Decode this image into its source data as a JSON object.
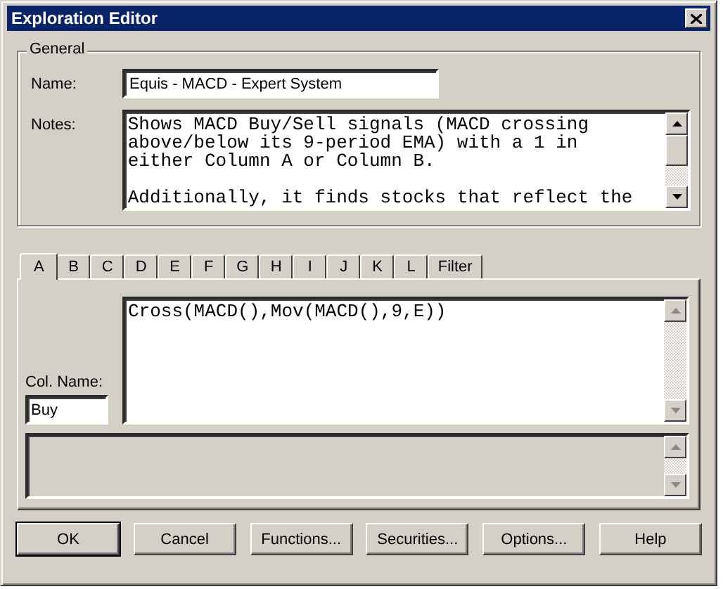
{
  "window": {
    "title": "Exploration Editor"
  },
  "general": {
    "title": "General",
    "name_label": "Name:",
    "name_value": "Equis - MACD - Expert System",
    "notes_label": "Notes:",
    "notes_paragraphs": [
      [
        "Shows MACD Buy/Sell signals (MACD crossing",
        "above/below its 9-period EMA) with a 1 in",
        "either Column A or Column B."
      ],
      [
        "Additionally, it finds stocks that reflect the"
      ]
    ]
  },
  "tabs": [
    {
      "label": "A",
      "selected": true
    },
    {
      "label": "B",
      "selected": false
    },
    {
      "label": "C",
      "selected": false
    },
    {
      "label": "D",
      "selected": false
    },
    {
      "label": "E",
      "selected": false
    },
    {
      "label": "F",
      "selected": false
    },
    {
      "label": "G",
      "selected": false
    },
    {
      "label": "H",
      "selected": false
    },
    {
      "label": "I",
      "selected": false
    },
    {
      "label": "J",
      "selected": false
    },
    {
      "label": "K",
      "selected": false
    },
    {
      "label": "L",
      "selected": false
    },
    {
      "label": "Filter",
      "selected": false
    }
  ],
  "column": {
    "formula": "Cross(MACD(),Mov(MACD(),9,E))",
    "col_name_label": "Col. Name:",
    "col_name_value": "Buy"
  },
  "buttons": [
    {
      "label": "OK",
      "default": true
    },
    {
      "label": "Cancel",
      "default": false
    },
    {
      "label": "Functions...",
      "default": false
    },
    {
      "label": "Securities...",
      "default": false
    },
    {
      "label": "Options...",
      "default": false
    },
    {
      "label": "Help",
      "default": false
    }
  ]
}
